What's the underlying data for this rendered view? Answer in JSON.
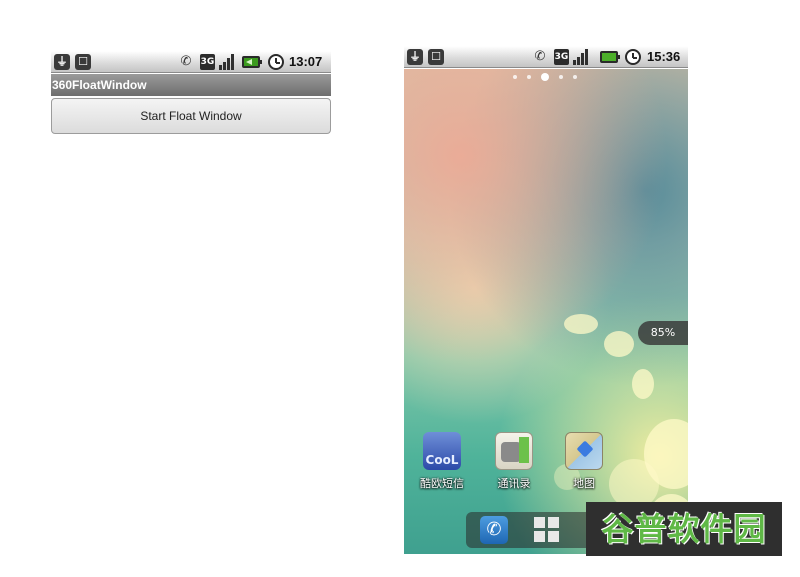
{
  "app_window": {
    "statusbar": {
      "usb_icon": "usb-icon",
      "app_icon": "android-icon",
      "network": "3G",
      "time": "13:07"
    },
    "title": "360FloatWindow",
    "start_button_label": "Start Float Window"
  },
  "phone": {
    "statusbar": {
      "network": "3G",
      "time": "15:36"
    },
    "page_indicator": {
      "pages": 5,
      "active_index": 2
    },
    "float_widget_text": "85%",
    "apps": [
      {
        "label": "酷欧短信",
        "icon": "sms-app-icon",
        "glyph_text": "CooL"
      },
      {
        "label": "通讯录",
        "icon": "contacts-app-icon"
      },
      {
        "label": "地图",
        "icon": "maps-app-icon"
      }
    ],
    "dock": {
      "phone_icon": "phone-icon",
      "launcher_icon": "app-drawer-icon"
    }
  },
  "watermark": {
    "text": "谷普软件园"
  },
  "colors": {
    "battery_green": "#4caf2a",
    "wallpaper_teal": "#4fb39a",
    "watermark_green": "#5fb846"
  }
}
